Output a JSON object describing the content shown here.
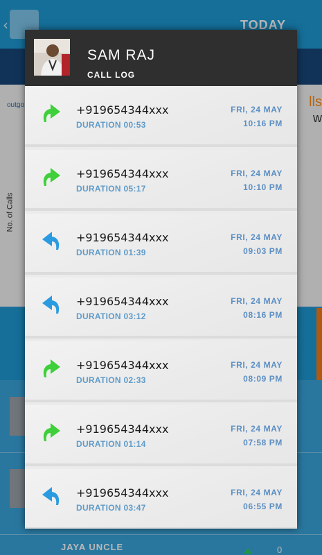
{
  "background": {
    "today_label": "TODAY",
    "bottom_contact_name": "JAYA UNCLE",
    "bottom_count": "0",
    "chart_axis_label": "No. of Calls",
    "legend_fragment": "outgo",
    "calls_fragment": "lls",
    "low_fragment": "w"
  },
  "dialog": {
    "contact_name": "SAM RAJ",
    "subtitle": "CALL LOG",
    "colors": {
      "outgoing": "#3ecf3a",
      "incoming": "#2a9be0",
      "text_accent": "#5b8fc4"
    },
    "calls": [
      {
        "direction": "outgoing",
        "icon": "outgoing-call-icon",
        "number": "+919654344xxx",
        "duration": "DURATION 00:53",
        "date": "FRI, 24 MAY",
        "time": "10:16 PM"
      },
      {
        "direction": "outgoing",
        "icon": "outgoing-call-icon",
        "number": "+919654344xxx",
        "duration": "DURATION 05:17",
        "date": "FRI, 24 MAY",
        "time": "10:10 PM"
      },
      {
        "direction": "incoming",
        "icon": "incoming-call-icon",
        "number": "+919654344xxx",
        "duration": "DURATION 01:39",
        "date": "FRI, 24 MAY",
        "time": "09:03 PM"
      },
      {
        "direction": "incoming",
        "icon": "incoming-call-icon",
        "number": "+919654344xxx",
        "duration": "DURATION 03:12",
        "date": "FRI, 24 MAY",
        "time": "08:16 PM"
      },
      {
        "direction": "outgoing",
        "icon": "outgoing-call-icon",
        "number": "+919654344xxx",
        "duration": "DURATION 02:33",
        "date": "FRI, 24 MAY",
        "time": "08:09 PM"
      },
      {
        "direction": "outgoing",
        "icon": "outgoing-call-icon",
        "number": "+919654344xxx",
        "duration": "DURATION 01:14",
        "date": "FRI, 24 MAY",
        "time": "07:58 PM"
      },
      {
        "direction": "incoming",
        "icon": "incoming-call-icon",
        "number": "+919654344xxx",
        "duration": "DURATION 03:47",
        "date": "FRI, 24 MAY",
        "time": "06:55 PM"
      }
    ]
  }
}
